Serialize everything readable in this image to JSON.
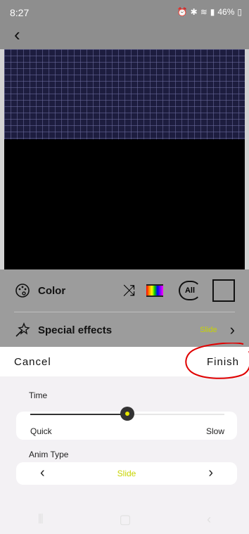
{
  "status": {
    "time": "8:27",
    "battery": "46%"
  },
  "panel": {
    "color_label": "Color",
    "all_label": "All",
    "effects_label": "Special effects",
    "effects_value": "Slide"
  },
  "sheet": {
    "cancel": "Cancel",
    "finish": "Finish",
    "time_label": "Time",
    "quick": "Quick",
    "slow": "Slow",
    "speed_fraction": 0.5,
    "anim_label": "Anim Type",
    "anim_value": "Slide"
  },
  "colors": {
    "accent": "#c8d400",
    "annotation": "#e00000"
  }
}
